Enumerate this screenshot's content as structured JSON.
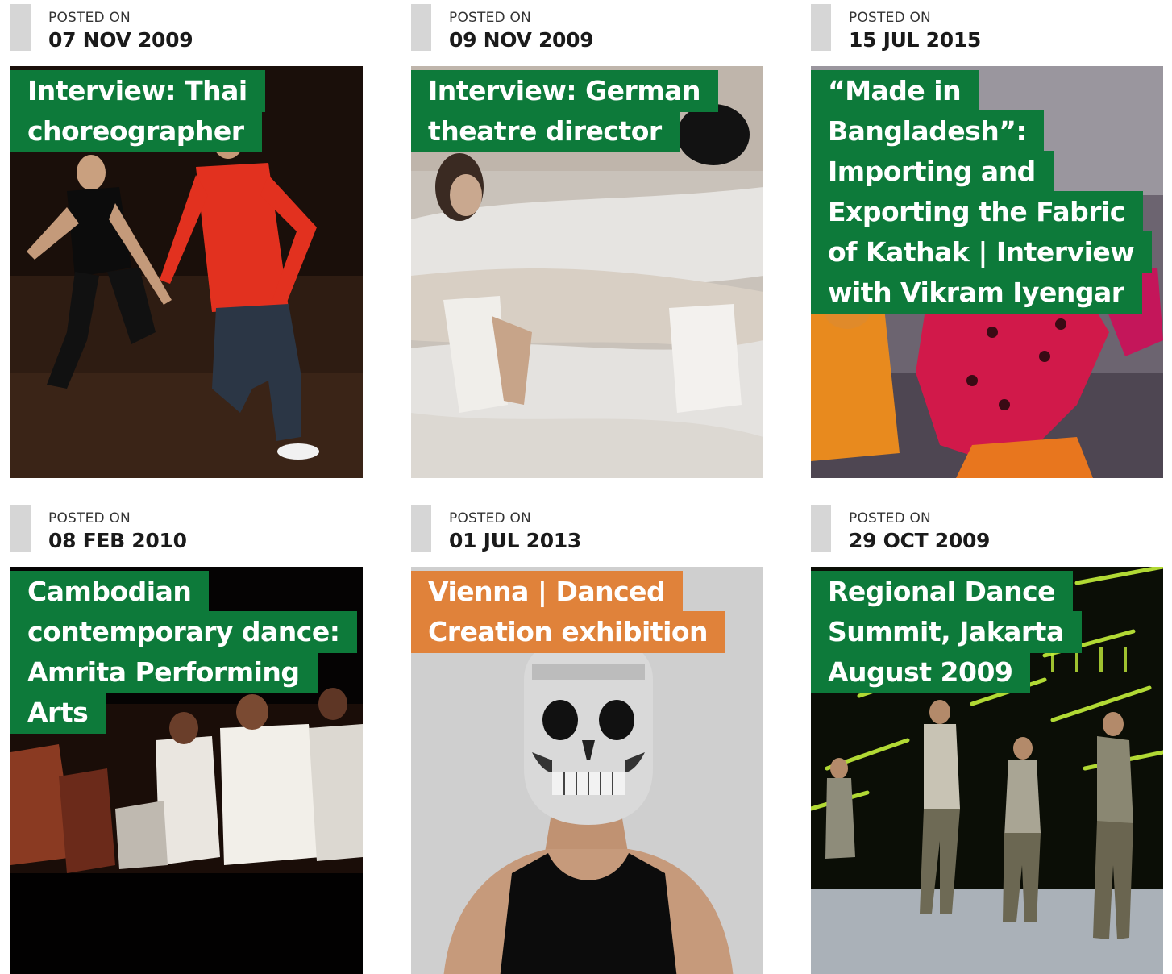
{
  "posted_label": "POSTED ON",
  "colors": {
    "title_green": "#0d7a3a",
    "title_orange": "#e0823a",
    "date_bar": "#d6d6d6"
  },
  "posts": [
    {
      "date": "07 NOV 2009",
      "title": "Interview: Thai choreographer",
      "title_color": "green",
      "image": "two male dancers on dark stage, one in red shirt"
    },
    {
      "date": "09 NOV 2009",
      "title": "Interview: German theatre director",
      "title_color": "green",
      "image": "dancers wrapped in white translucent fabric"
    },
    {
      "date": "15 JUL 2015",
      "title": "“Made in Bangladesh”: Importing and Exporting the Fabric of Kathak | Interview with Vikram Iyengar",
      "title_color": "green",
      "image": "Kathak dancers in red and orange costumes"
    },
    {
      "date": "08 FEB 2010",
      "title": "Cambodian contemporary dance: Amrita Performing Arts",
      "title_color": "green",
      "image": "dancers in white seated on dark stage"
    },
    {
      "date": "01 JUL 2013",
      "title": "Vienna | Danced Creation exhibition",
      "title_color": "orange",
      "image": "man in black tank top wearing silver skull mask"
    },
    {
      "date": "29 OCT 2009",
      "title": "Regional Dance Summit, Jakarta August 2009",
      "title_color": "green",
      "image": "dancers on stage with green neon light streaks"
    }
  ]
}
